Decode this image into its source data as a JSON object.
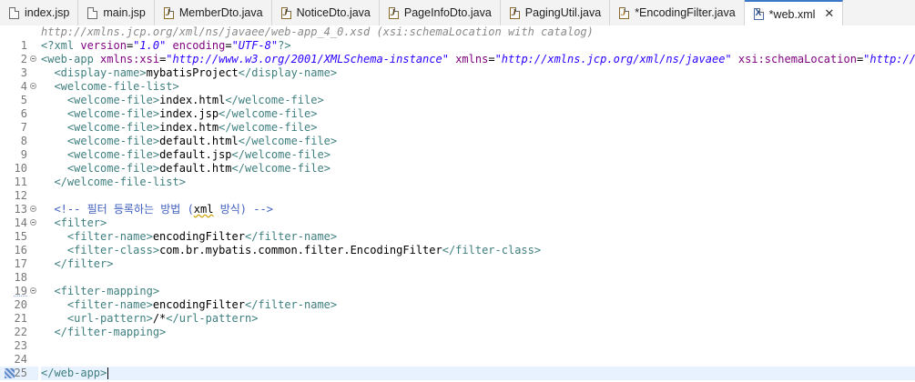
{
  "tabs": [
    {
      "label": "index.jsp",
      "icon": "jsp-file-icon",
      "active": false
    },
    {
      "label": "main.jsp",
      "icon": "jsp-file-icon",
      "active": false
    },
    {
      "label": "MemberDto.java",
      "icon": "java-file-icon",
      "active": false
    },
    {
      "label": "NoticeDto.java",
      "icon": "java-file-icon",
      "active": false
    },
    {
      "label": "PageInfoDto.java",
      "icon": "java-file-icon",
      "active": false
    },
    {
      "label": "PagingUtil.java",
      "icon": "java-file-icon",
      "active": false
    },
    {
      "label": "*EncodingFilter.java",
      "icon": "java-file-icon",
      "active": false
    },
    {
      "label": "*web.xml",
      "icon": "xml-file-icon",
      "active": true
    }
  ],
  "close_glyph": "✕",
  "editor": {
    "schema_hint": "http://xmlns.jcp.org/xml/ns/javaee/web-app_4_0.xsd (xsi:schemaLocation with catalog)",
    "current_line": 25,
    "lines": [
      {
        "n": "1",
        "fold": false,
        "tokens": [
          [
            "tag",
            "<?xml "
          ],
          [
            "attr",
            "version"
          ],
          [
            "txt",
            "="
          ],
          [
            "val",
            "\"1.0\""
          ],
          [
            "txt",
            " "
          ],
          [
            "attr",
            "encoding"
          ],
          [
            "txt",
            "="
          ],
          [
            "val",
            "\"UTF-8\""
          ],
          [
            "tag",
            "?>"
          ]
        ]
      },
      {
        "n": "2",
        "fold": true,
        "tokens": [
          [
            "tag",
            "<web-app "
          ],
          [
            "attr",
            "xmlns:xsi"
          ],
          [
            "txt",
            "="
          ],
          [
            "val",
            "\"http://www.w3.org/2001/XMLSchema-instance\""
          ],
          [
            "txt",
            " "
          ],
          [
            "attr",
            "xmlns"
          ],
          [
            "txt",
            "="
          ],
          [
            "val",
            "\"http://xmlns.jcp.org/xml/ns/javaee\""
          ],
          [
            "txt",
            " "
          ],
          [
            "attr",
            "xsi:schemaLocation"
          ],
          [
            "txt",
            "="
          ],
          [
            "val",
            "\"http://xmlns"
          ]
        ]
      },
      {
        "n": "3",
        "fold": false,
        "tokens": [
          [
            "txt",
            "  "
          ],
          [
            "tag",
            "<display-name>"
          ],
          [
            "txt",
            "mybatisProject"
          ],
          [
            "tag",
            "</display-name>"
          ]
        ]
      },
      {
        "n": "4",
        "fold": true,
        "tokens": [
          [
            "txt",
            "  "
          ],
          [
            "tag",
            "<welcome-file-list>"
          ]
        ]
      },
      {
        "n": "5",
        "fold": false,
        "tokens": [
          [
            "txt",
            "    "
          ],
          [
            "tag",
            "<welcome-file>"
          ],
          [
            "txt",
            "index.html"
          ],
          [
            "tag",
            "</welcome-file>"
          ]
        ]
      },
      {
        "n": "6",
        "fold": false,
        "tokens": [
          [
            "txt",
            "    "
          ],
          [
            "tag",
            "<welcome-file>"
          ],
          [
            "txt",
            "index.jsp"
          ],
          [
            "tag",
            "</welcome-file>"
          ]
        ]
      },
      {
        "n": "7",
        "fold": false,
        "tokens": [
          [
            "txt",
            "    "
          ],
          [
            "tag",
            "<welcome-file>"
          ],
          [
            "txt",
            "index.htm"
          ],
          [
            "tag",
            "</welcome-file>"
          ]
        ]
      },
      {
        "n": "8",
        "fold": false,
        "tokens": [
          [
            "txt",
            "    "
          ],
          [
            "tag",
            "<welcome-file>"
          ],
          [
            "txt",
            "default.html"
          ],
          [
            "tag",
            "</welcome-file>"
          ]
        ]
      },
      {
        "n": "9",
        "fold": false,
        "tokens": [
          [
            "txt",
            "    "
          ],
          [
            "tag",
            "<welcome-file>"
          ],
          [
            "txt",
            "default.jsp"
          ],
          [
            "tag",
            "</welcome-file>"
          ]
        ]
      },
      {
        "n": "10",
        "fold": false,
        "tokens": [
          [
            "txt",
            "    "
          ],
          [
            "tag",
            "<welcome-file>"
          ],
          [
            "txt",
            "default.htm"
          ],
          [
            "tag",
            "</welcome-file>"
          ]
        ]
      },
      {
        "n": "11",
        "fold": false,
        "tokens": [
          [
            "txt",
            "  "
          ],
          [
            "tag",
            "</welcome-file-list>"
          ]
        ]
      },
      {
        "n": "12",
        "fold": false,
        "tokens": []
      },
      {
        "n": "13",
        "fold": true,
        "tokens": [
          [
            "txt",
            "  "
          ],
          [
            "com",
            "<!-- 필터 등록하는 방법 ("
          ],
          [
            "err",
            "xml"
          ],
          [
            "com",
            " 방식) -->"
          ]
        ]
      },
      {
        "n": "14",
        "fold": true,
        "tokens": [
          [
            "txt",
            "  "
          ],
          [
            "tag",
            "<filter>"
          ]
        ]
      },
      {
        "n": "15",
        "fold": false,
        "tokens": [
          [
            "txt",
            "    "
          ],
          [
            "tag",
            "<filter-name>"
          ],
          [
            "txt",
            "encodingFilter"
          ],
          [
            "tag",
            "</filter-name>"
          ]
        ]
      },
      {
        "n": "16",
        "fold": false,
        "tokens": [
          [
            "txt",
            "    "
          ],
          [
            "tag",
            "<filter-class>"
          ],
          [
            "txt",
            "com.br.mybatis.common.filter.EncodingFilter"
          ],
          [
            "tag",
            "</filter-class>"
          ]
        ]
      },
      {
        "n": "17",
        "fold": false,
        "tokens": [
          [
            "txt",
            "  "
          ],
          [
            "tag",
            "</filter>"
          ]
        ]
      },
      {
        "n": "18",
        "fold": false,
        "tokens": []
      },
      {
        "n": "19",
        "fold": true,
        "marked": true,
        "tokens": [
          [
            "txt",
            "  "
          ],
          [
            "tag",
            "<filter-mapping>"
          ]
        ]
      },
      {
        "n": "20",
        "fold": false,
        "tokens": [
          [
            "txt",
            "    "
          ],
          [
            "tag",
            "<filter-name>"
          ],
          [
            "txt",
            "encodingFilter"
          ],
          [
            "tag",
            "</filter-name>"
          ]
        ]
      },
      {
        "n": "21",
        "fold": false,
        "tokens": [
          [
            "txt",
            "    "
          ],
          [
            "tag",
            "<url-pattern>"
          ],
          [
            "txt",
            "/*"
          ],
          [
            "tag",
            "</url-pattern>"
          ]
        ]
      },
      {
        "n": "22",
        "fold": false,
        "tokens": [
          [
            "txt",
            "  "
          ],
          [
            "tag",
            "</filter-mapping>"
          ]
        ]
      },
      {
        "n": "23",
        "fold": false,
        "tokens": []
      },
      {
        "n": "24",
        "fold": false,
        "tokens": []
      },
      {
        "n": "25",
        "fold": false,
        "bookmark": true,
        "tokens": [
          [
            "tag",
            "</web-app>"
          ]
        ]
      }
    ]
  }
}
